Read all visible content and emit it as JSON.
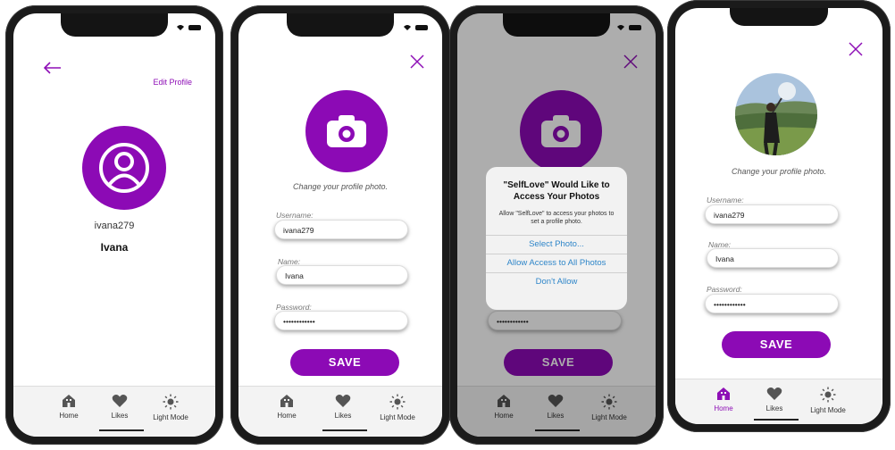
{
  "colors": {
    "accent": "#8c0ab5",
    "link": "#2f86c9",
    "tab_bg": "#f3f3f3"
  },
  "icons": [
    "back-arrow-icon",
    "close-icon",
    "camera-icon",
    "user-icon",
    "home-icon",
    "heart-icon",
    "sun-icon",
    "wifi-icon",
    "battery-icon"
  ],
  "screen1": {
    "edit_profile": "Edit Profile",
    "username": "ivana279",
    "name": "Ivana"
  },
  "screen2": {
    "caption": "Change your profile photo.",
    "username_label": "Username:",
    "username_value": "ivana279",
    "name_label": "Name:",
    "name_value": "Ivana",
    "password_label": "Password:",
    "password_value": "••••••••••••",
    "save": "SAVE"
  },
  "screen3": {
    "dialog_title": "\"SelfLove\" Would Like to Access Your Photos",
    "dialog_message": "Allow \"SelfLove\" to access your photos to set a profile photo.",
    "options": [
      "Select Photo...",
      "Allow Access to All Photos",
      "Don't Allow"
    ],
    "password_value": "••••••••••••",
    "save": "SAVE"
  },
  "screen4": {
    "caption": "Change your profile photo.",
    "username_label": "Username:",
    "username_value": "ivana279",
    "name_label": "Name:",
    "name_value": "Ivana",
    "password_label": "Password:",
    "password_value": "••••••••••••",
    "save": "SAVE"
  },
  "tabs": {
    "home": "Home",
    "likes": "Likes",
    "light_mode": "Light Mode"
  }
}
